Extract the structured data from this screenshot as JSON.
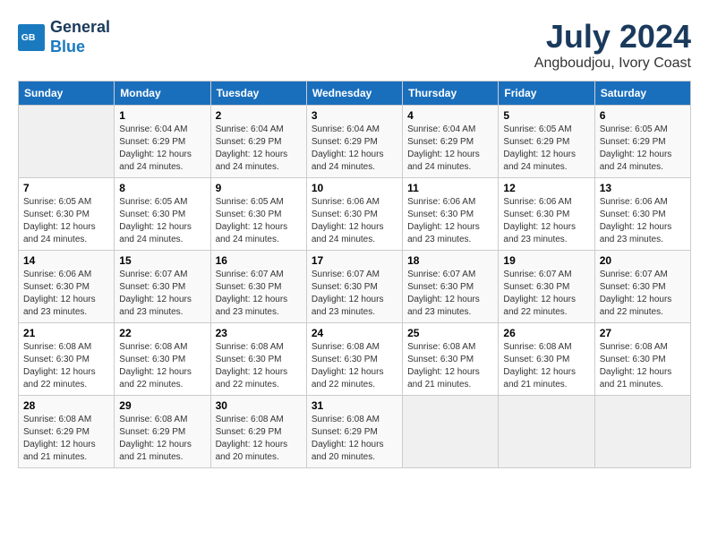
{
  "header": {
    "logo_line1": "General",
    "logo_line2": "Blue",
    "month_year": "July 2024",
    "location": "Angboudjou, Ivory Coast"
  },
  "weekdays": [
    "Sunday",
    "Monday",
    "Tuesday",
    "Wednesday",
    "Thursday",
    "Friday",
    "Saturday"
  ],
  "weeks": [
    [
      {
        "day": "",
        "info": ""
      },
      {
        "day": "1",
        "info": "Sunrise: 6:04 AM\nSunset: 6:29 PM\nDaylight: 12 hours\nand 24 minutes."
      },
      {
        "day": "2",
        "info": "Sunrise: 6:04 AM\nSunset: 6:29 PM\nDaylight: 12 hours\nand 24 minutes."
      },
      {
        "day": "3",
        "info": "Sunrise: 6:04 AM\nSunset: 6:29 PM\nDaylight: 12 hours\nand 24 minutes."
      },
      {
        "day": "4",
        "info": "Sunrise: 6:04 AM\nSunset: 6:29 PM\nDaylight: 12 hours\nand 24 minutes."
      },
      {
        "day": "5",
        "info": "Sunrise: 6:05 AM\nSunset: 6:29 PM\nDaylight: 12 hours\nand 24 minutes."
      },
      {
        "day": "6",
        "info": "Sunrise: 6:05 AM\nSunset: 6:29 PM\nDaylight: 12 hours\nand 24 minutes."
      }
    ],
    [
      {
        "day": "7",
        "info": "Sunrise: 6:05 AM\nSunset: 6:30 PM\nDaylight: 12 hours\nand 24 minutes."
      },
      {
        "day": "8",
        "info": "Sunrise: 6:05 AM\nSunset: 6:30 PM\nDaylight: 12 hours\nand 24 minutes."
      },
      {
        "day": "9",
        "info": "Sunrise: 6:05 AM\nSunset: 6:30 PM\nDaylight: 12 hours\nand 24 minutes."
      },
      {
        "day": "10",
        "info": "Sunrise: 6:06 AM\nSunset: 6:30 PM\nDaylight: 12 hours\nand 24 minutes."
      },
      {
        "day": "11",
        "info": "Sunrise: 6:06 AM\nSunset: 6:30 PM\nDaylight: 12 hours\nand 23 minutes."
      },
      {
        "day": "12",
        "info": "Sunrise: 6:06 AM\nSunset: 6:30 PM\nDaylight: 12 hours\nand 23 minutes."
      },
      {
        "day": "13",
        "info": "Sunrise: 6:06 AM\nSunset: 6:30 PM\nDaylight: 12 hours\nand 23 minutes."
      }
    ],
    [
      {
        "day": "14",
        "info": "Sunrise: 6:06 AM\nSunset: 6:30 PM\nDaylight: 12 hours\nand 23 minutes."
      },
      {
        "day": "15",
        "info": "Sunrise: 6:07 AM\nSunset: 6:30 PM\nDaylight: 12 hours\nand 23 minutes."
      },
      {
        "day": "16",
        "info": "Sunrise: 6:07 AM\nSunset: 6:30 PM\nDaylight: 12 hours\nand 23 minutes."
      },
      {
        "day": "17",
        "info": "Sunrise: 6:07 AM\nSunset: 6:30 PM\nDaylight: 12 hours\nand 23 minutes."
      },
      {
        "day": "18",
        "info": "Sunrise: 6:07 AM\nSunset: 6:30 PM\nDaylight: 12 hours\nand 23 minutes."
      },
      {
        "day": "19",
        "info": "Sunrise: 6:07 AM\nSunset: 6:30 PM\nDaylight: 12 hours\nand 22 minutes."
      },
      {
        "day": "20",
        "info": "Sunrise: 6:07 AM\nSunset: 6:30 PM\nDaylight: 12 hours\nand 22 minutes."
      }
    ],
    [
      {
        "day": "21",
        "info": "Sunrise: 6:08 AM\nSunset: 6:30 PM\nDaylight: 12 hours\nand 22 minutes."
      },
      {
        "day": "22",
        "info": "Sunrise: 6:08 AM\nSunset: 6:30 PM\nDaylight: 12 hours\nand 22 minutes."
      },
      {
        "day": "23",
        "info": "Sunrise: 6:08 AM\nSunset: 6:30 PM\nDaylight: 12 hours\nand 22 minutes."
      },
      {
        "day": "24",
        "info": "Sunrise: 6:08 AM\nSunset: 6:30 PM\nDaylight: 12 hours\nand 22 minutes."
      },
      {
        "day": "25",
        "info": "Sunrise: 6:08 AM\nSunset: 6:30 PM\nDaylight: 12 hours\nand 21 minutes."
      },
      {
        "day": "26",
        "info": "Sunrise: 6:08 AM\nSunset: 6:30 PM\nDaylight: 12 hours\nand 21 minutes."
      },
      {
        "day": "27",
        "info": "Sunrise: 6:08 AM\nSunset: 6:30 PM\nDaylight: 12 hours\nand 21 minutes."
      }
    ],
    [
      {
        "day": "28",
        "info": "Sunrise: 6:08 AM\nSunset: 6:29 PM\nDaylight: 12 hours\nand 21 minutes."
      },
      {
        "day": "29",
        "info": "Sunrise: 6:08 AM\nSunset: 6:29 PM\nDaylight: 12 hours\nand 21 minutes."
      },
      {
        "day": "30",
        "info": "Sunrise: 6:08 AM\nSunset: 6:29 PM\nDaylight: 12 hours\nand 20 minutes."
      },
      {
        "day": "31",
        "info": "Sunrise: 6:08 AM\nSunset: 6:29 PM\nDaylight: 12 hours\nand 20 minutes."
      },
      {
        "day": "",
        "info": ""
      },
      {
        "day": "",
        "info": ""
      },
      {
        "day": "",
        "info": ""
      }
    ]
  ]
}
